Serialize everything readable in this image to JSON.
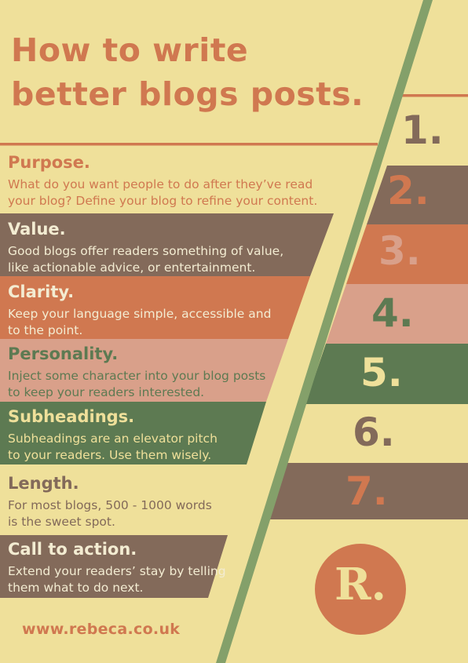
{
  "title": {
    "line1": "How to write",
    "line2": "better blogs posts."
  },
  "sections": [
    {
      "heading": "Purpose.",
      "line1": "What do you want people to do after they’ve read",
      "line2": "your blog? Define your blog to refine your content.",
      "number": "1."
    },
    {
      "heading": "Value.",
      "line1": "Good blogs offer readers something of value,",
      "line2": "like actionable advice, or entertainment.",
      "number": "2."
    },
    {
      "heading": "Clarity.",
      "line1": "Keep your language simple, accessible and",
      "line2": "to the point.",
      "number": "3."
    },
    {
      "heading": "Personality.",
      "line1": "Inject some character into your blog posts",
      "line2": "to keep your readers interested.",
      "number": "4."
    },
    {
      "heading": "Subheadings.",
      "line1": "Subheadings are an elevator pitch",
      "line2": "to your readers. Use them wisely.",
      "number": "5."
    },
    {
      "heading": "Length.",
      "line1": "For most blogs, 500 - 1000 words",
      "line2": "is the sweet spot.",
      "number": "6."
    },
    {
      "heading": "Call to action.",
      "line1": "Extend your readers’ stay by telling",
      "line2": "them what to do next.",
      "number": "7."
    }
  ],
  "logo": {
    "text": "R."
  },
  "website": "www.rebeca.co.uk",
  "colors": {
    "background": "#efe09a",
    "terracotta": "#d07850",
    "brown": "#836a5a",
    "pink": "#d9a08a",
    "green": "#5d7a52",
    "diagonal": "#84a06a"
  }
}
